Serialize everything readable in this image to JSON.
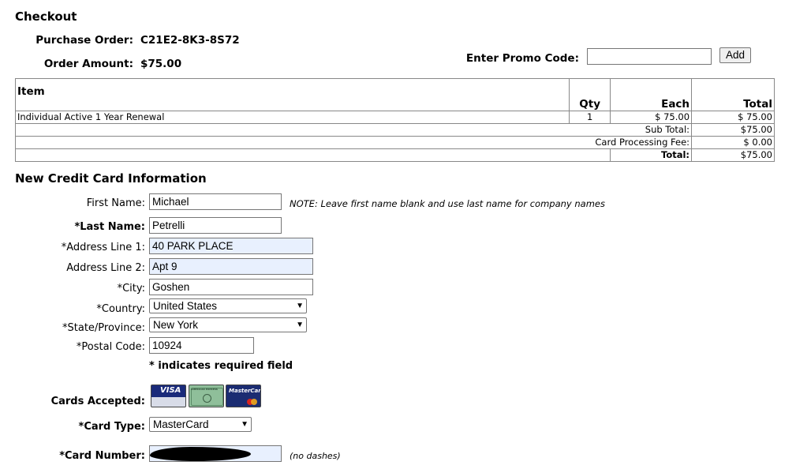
{
  "checkout": {
    "title": "Checkout",
    "purchase_order_label": "Purchase Order:",
    "purchase_order": "C21E2-8K3-8S72",
    "order_amount_label": "Order Amount:",
    "order_amount": "$75.00",
    "promo_label": "Enter Promo Code:",
    "promo_value": "",
    "add_button": "Add"
  },
  "order_table": {
    "headers": {
      "item": "Item",
      "qty": "Qty",
      "each": "Each",
      "total": "Total"
    },
    "rows": [
      {
        "item": "Individual Active 1 Year Renewal",
        "qty": "1",
        "each": "$ 75.00",
        "total": "$ 75.00"
      }
    ],
    "subtotal_label": "Sub Total:",
    "subtotal": "$75.00",
    "fee_label": "Card Processing Fee:",
    "fee": "$ 0.00",
    "total_label": "Total:",
    "total": "$75.00"
  },
  "card_form": {
    "title": "New Credit Card Information",
    "first_name_label": "First Name:",
    "first_name": "Michael",
    "first_name_note": "NOTE: Leave first name blank and use last name for company names",
    "last_name_label": "*Last Name:",
    "last_name": "Petrelli",
    "address1_label": "*Address Line 1:",
    "address1": "40 PARK PLACE",
    "address2_label": "Address Line 2:",
    "address2": "Apt 9",
    "city_label": "*City:",
    "city": "Goshen",
    "country_label": "*Country:",
    "country": "United States",
    "state_label": "*State/Province:",
    "state": "New York",
    "postal_label": "*Postal Code:",
    "postal": "10924",
    "required_note": "* indicates required field",
    "cards_label": "Cards Accepted:",
    "cards": [
      "VISA",
      "AMERICAN EXPRESS",
      "MasterCard"
    ],
    "card_type_label": "*Card Type:",
    "card_type": "MasterCard",
    "card_number_label": "*Card Number:",
    "card_number_note": "(no dashes)"
  },
  "icons": {
    "dropdown": "chevron-down-icon",
    "redaction": "redaction-mark"
  }
}
